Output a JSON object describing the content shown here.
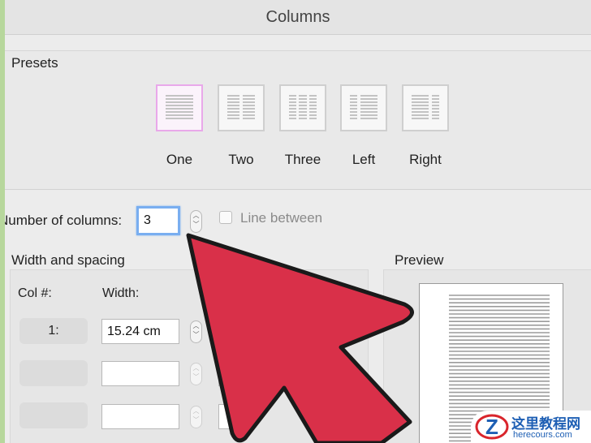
{
  "dialog": {
    "title": "Columns"
  },
  "presets": {
    "label": "Presets",
    "items": [
      {
        "label": "One",
        "selected": true
      },
      {
        "label": "Two",
        "selected": false
      },
      {
        "label": "Three",
        "selected": false
      },
      {
        "label": "Left",
        "selected": false
      },
      {
        "label": "Right",
        "selected": false
      }
    ]
  },
  "columns": {
    "label": "Number of columns:",
    "value": "3"
  },
  "line_between": {
    "label": "Line between",
    "checked": false
  },
  "width_spacing": {
    "label": "Width and spacing",
    "col_header": "Col #:",
    "width_header": "Width:",
    "rows": [
      {
        "col": "1:",
        "width": "15.24 cm"
      },
      {
        "col": "",
        "width": ""
      },
      {
        "col": "",
        "width": ""
      }
    ]
  },
  "preview": {
    "label": "Preview"
  },
  "watermark": {
    "text": "这里教程网",
    "url_text": "herecours.com"
  },
  "colors": {
    "arrow": "#d93049",
    "focus": "#79aef0",
    "selected_border": "#e9a8ea"
  }
}
